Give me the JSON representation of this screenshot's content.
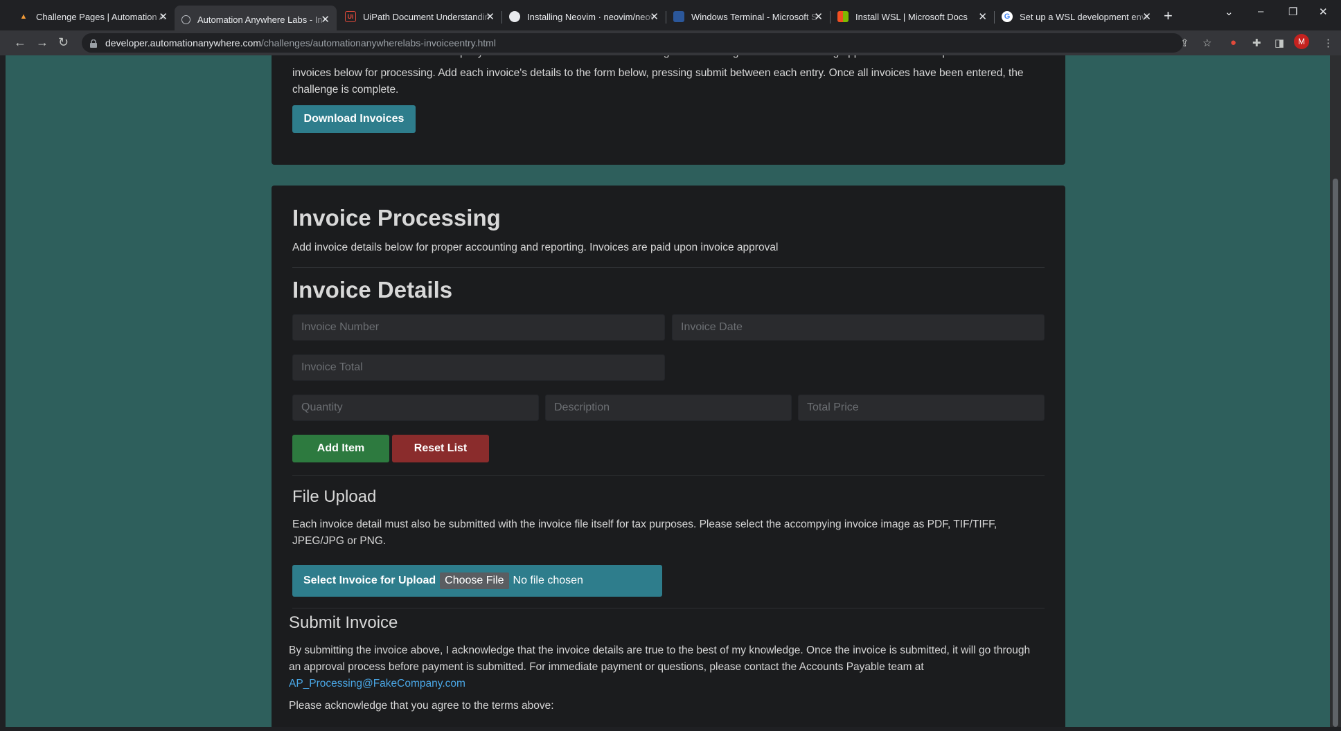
{
  "browser": {
    "tabs": [
      {
        "title": "Challenge Pages | Automation A",
        "active": false
      },
      {
        "title": "Automation Anywhere Labs - In",
        "active": true
      },
      {
        "title": "UiPath Document Understandin",
        "active": false
      },
      {
        "title": "Installing Neovim · neovim/neov",
        "active": false
      },
      {
        "title": "Windows Terminal - Microsoft S",
        "active": false
      },
      {
        "title": "Install WSL | Microsoft Docs",
        "active": false
      },
      {
        "title": "Set up a WSL development envi",
        "active": false
      }
    ],
    "new_tab": "+",
    "url_host": "developer.automationanywhere.com",
    "url_path": "/challenges/automationanywherelabs-invoiceentry.html",
    "profile_initial": "M",
    "accent": "#c5221f"
  },
  "intro": {
    "text_partial": "invoices received from various company vendors must be entered into the integrated invoicing solutions accounting app. Download the zip of the",
    "text": "invoices below for processing. Add each invoice's details to the form below, pressing submit between each entry. Once all invoices have been entered, the challenge is complete.",
    "download_button": "Download Invoices"
  },
  "processing": {
    "title": "Invoice Processing",
    "subtitle": "Add invoice details below for proper accounting and reporting. Invoices are paid upon invoice approval"
  },
  "details": {
    "title": "Invoice Details",
    "invoice_number_placeholder": "Invoice Number",
    "invoice_date_placeholder": "Invoice Date",
    "invoice_total_placeholder": "Invoice Total",
    "quantity_placeholder": "Quantity",
    "description_placeholder": "Description",
    "total_price_placeholder": "Total Price",
    "add_item_button": "Add Item",
    "reset_list_button": "Reset List"
  },
  "upload": {
    "title": "File Upload",
    "text": "Each invoice detail must also be submitted with the invoice file itself for tax purposes. Please select the accompying invoice image as PDF, TIF/TIFF, JPEG/JPG or PNG.",
    "label": "Select Invoice for Upload",
    "choose_button": "Choose File",
    "status": "No file chosen"
  },
  "submit": {
    "title": "Submit Invoice",
    "text": "By submitting the invoice above, I acknowledge that the invoice details are true to the best of my knowledge. Once the invoice is submitted, it will go through an approval process before payment is submitted. For immediate payment or questions, please contact the Accounts Payable team at",
    "email": "AP_Processing@FakeCompany.com",
    "acknowledge": "Please acknowledge that you agree to the terms above:"
  },
  "colors": {
    "page_bg": "#2e5f5c",
    "card_bg": "#1b1c1e",
    "primary_button": "#2e7d8c",
    "success_button": "#2d7a3f",
    "danger_button": "#8a2c2c"
  }
}
